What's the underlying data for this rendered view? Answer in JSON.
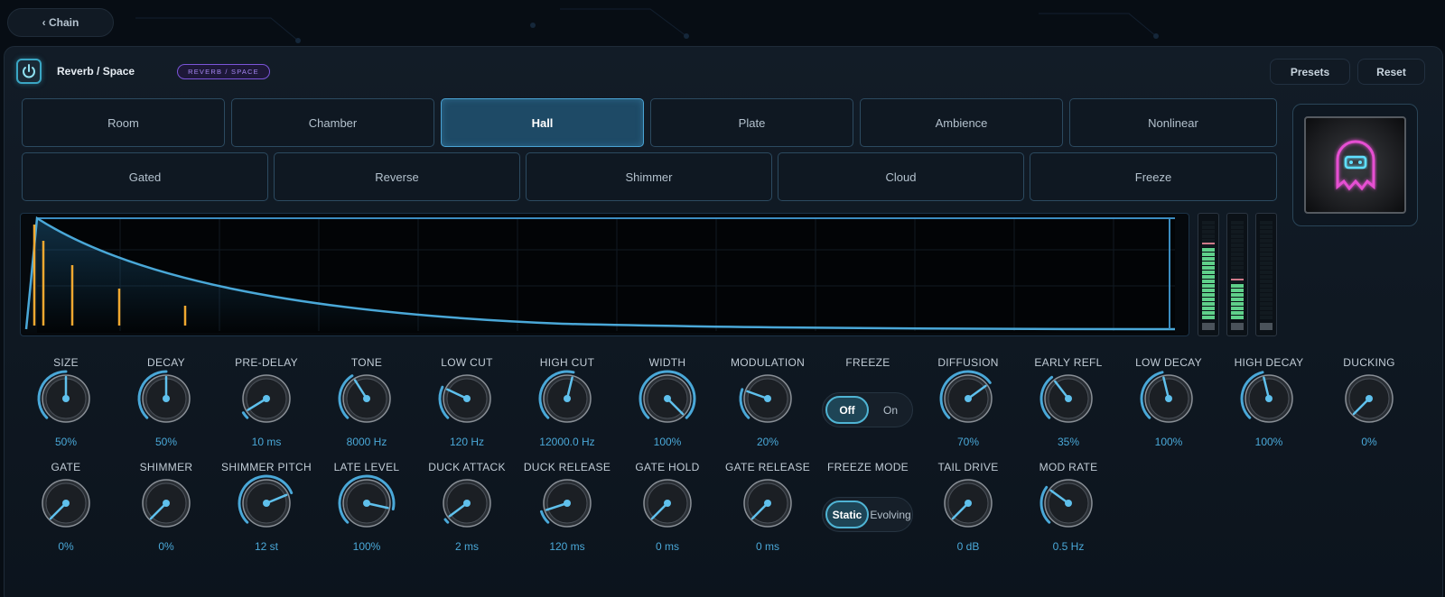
{
  "nav": {
    "back_label": "‹ Chain"
  },
  "header": {
    "title": "Reverb / Space",
    "badge": "REVERB / SPACE",
    "presets_label": "Presets",
    "reset_label": "Reset"
  },
  "modes": {
    "row1": [
      "Room",
      "Chamber",
      "Hall",
      "Plate",
      "Ambience",
      "Nonlinear"
    ],
    "row2": [
      "Gated",
      "Reverse",
      "Shimmer",
      "Cloud",
      "Freeze"
    ],
    "selected": "Hall"
  },
  "knobs_row1": [
    {
      "label": "SIZE",
      "value": "50%",
      "pos": 0.5
    },
    {
      "label": "DECAY",
      "value": "50%",
      "pos": 0.5
    },
    {
      "label": "PRE-DELAY",
      "value": "10 ms",
      "pos": 0.05
    },
    {
      "label": "TONE",
      "value": "8000 Hz",
      "pos": 0.38
    },
    {
      "label": "LOW CUT",
      "value": "120 Hz",
      "pos": 0.26
    },
    {
      "label": "HIGH CUT",
      "value": "12000.0 Hz",
      "pos": 0.55
    },
    {
      "label": "WIDTH",
      "value": "100%",
      "pos": 1.0
    },
    {
      "label": "MODULATION",
      "value": "20%",
      "pos": 0.24
    },
    {
      "label": "DIFFUSION",
      "value": "70%",
      "pos": 0.7
    },
    {
      "label": "EARLY REFL",
      "value": "35%",
      "pos": 0.36
    },
    {
      "label": "LOW DECAY",
      "value": "100%",
      "pos": 0.45
    },
    {
      "label": "HIGH DECAY",
      "value": "100%",
      "pos": 0.45
    },
    {
      "label": "DUCKING",
      "value": "0%",
      "pos": 0.0
    }
  ],
  "knobs_row2": [
    {
      "label": "GATE",
      "value": "0%",
      "pos": 0.0
    },
    {
      "label": "SHIMMER",
      "value": "0%",
      "pos": 0.0
    },
    {
      "label": "SHIMMER PITCH",
      "value": "12 st",
      "pos": 0.75
    },
    {
      "label": "LATE LEVEL",
      "value": "100%",
      "pos": 0.88
    },
    {
      "label": "DUCK ATTACK",
      "value": "2 ms",
      "pos": 0.03
    },
    {
      "label": "DUCK RELEASE",
      "value": "120 ms",
      "pos": 0.1
    },
    {
      "label": "GATE HOLD",
      "value": "0 ms",
      "pos": 0.0
    },
    {
      "label": "GATE RELEASE",
      "value": "0 ms",
      "pos": 0.0
    },
    {
      "label": "TAIL DRIVE",
      "value": "0 dB",
      "pos": 0.0
    },
    {
      "label": "MOD RATE",
      "value": "0.5 Hz",
      "pos": 0.3
    }
  ],
  "freeze": {
    "label": "FREEZE",
    "off": "Off",
    "on": "On",
    "state": "Off"
  },
  "freeze_mode": {
    "label": "FREEZE MODE",
    "static": "Static",
    "evolving": "Evolving",
    "state": "Static"
  },
  "meters": [
    0.72,
    0.35,
    0.0
  ],
  "colors": {
    "accent": "#4aa8d8",
    "reflections": "#f0a830",
    "meter": "#5fd08a",
    "badge": "#a586f2",
    "art_glow": "#e64fd2"
  }
}
